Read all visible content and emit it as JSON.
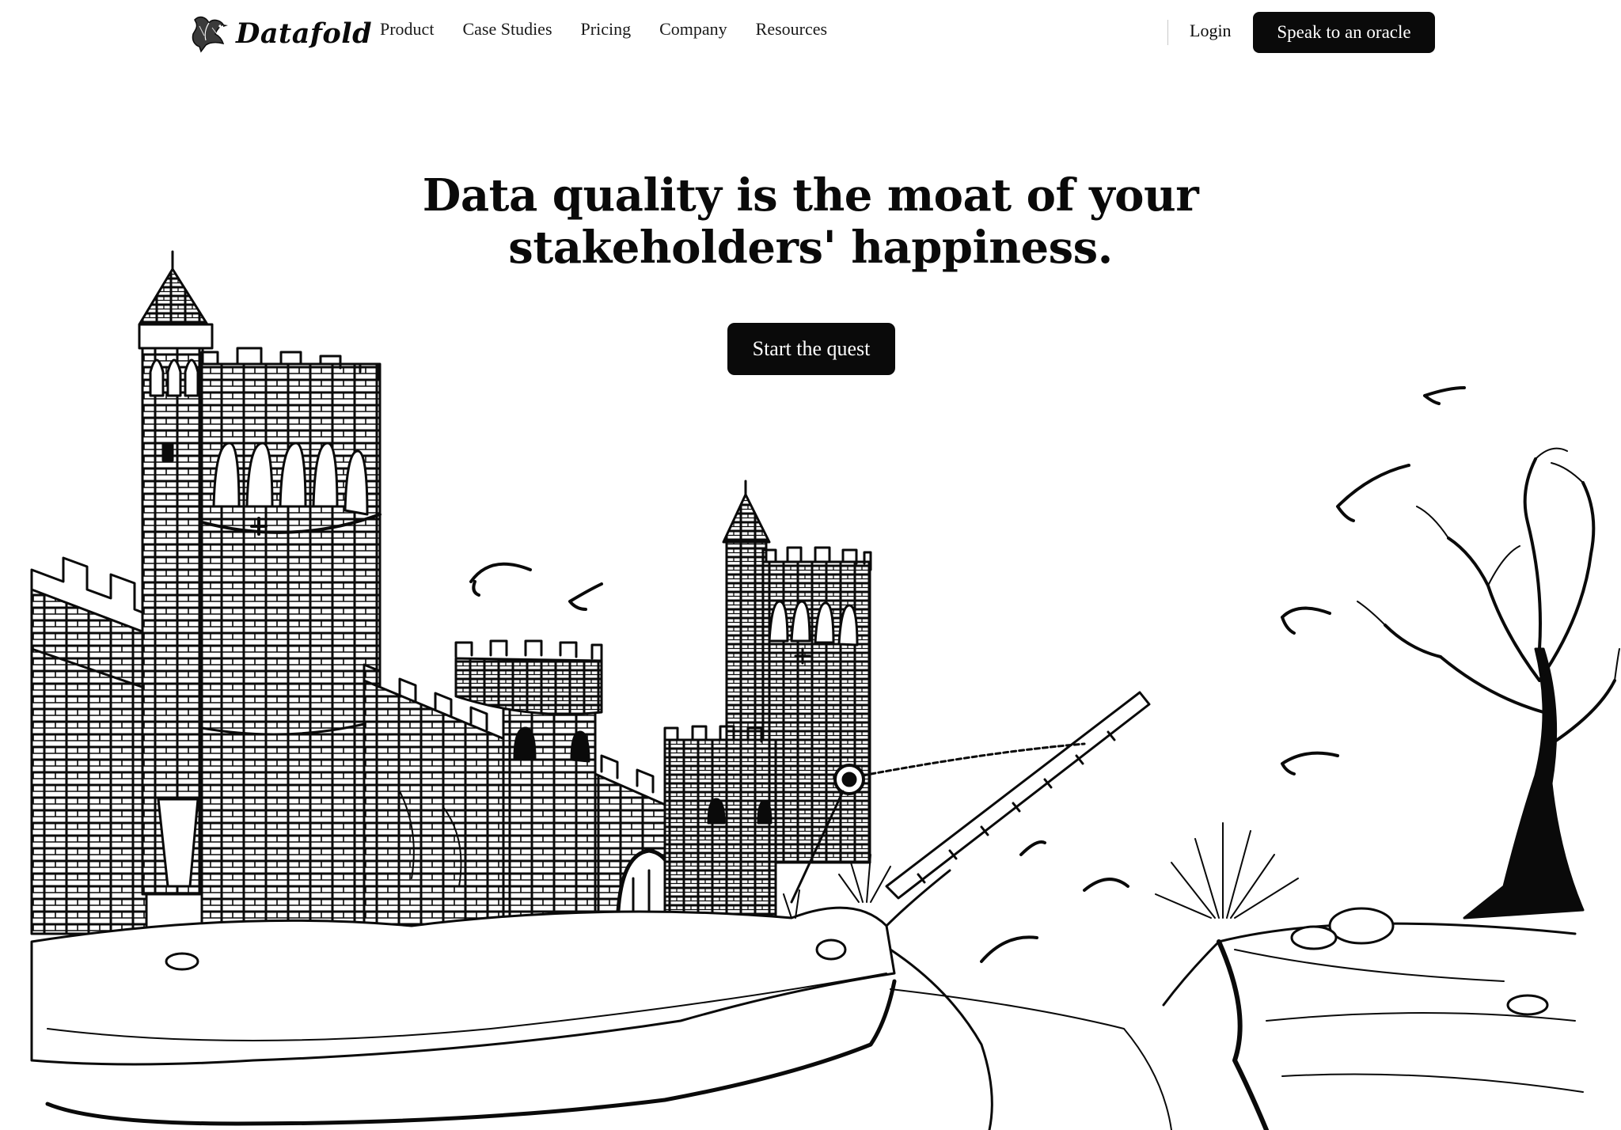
{
  "brand": {
    "name": "Datafold",
    "logo_icon": "bird-icon"
  },
  "nav": {
    "links": [
      "Product",
      "Case Studies",
      "Pricing",
      "Company",
      "Resources"
    ],
    "login": "Login",
    "cta": "Speak to an oracle"
  },
  "hero": {
    "headline_line1": "Data quality is the moat of your",
    "headline_line2": "stakeholders' happiness.",
    "cta": "Start the quest"
  },
  "colors": {
    "ink": "#0a0a0a",
    "background": "#ffffff"
  }
}
